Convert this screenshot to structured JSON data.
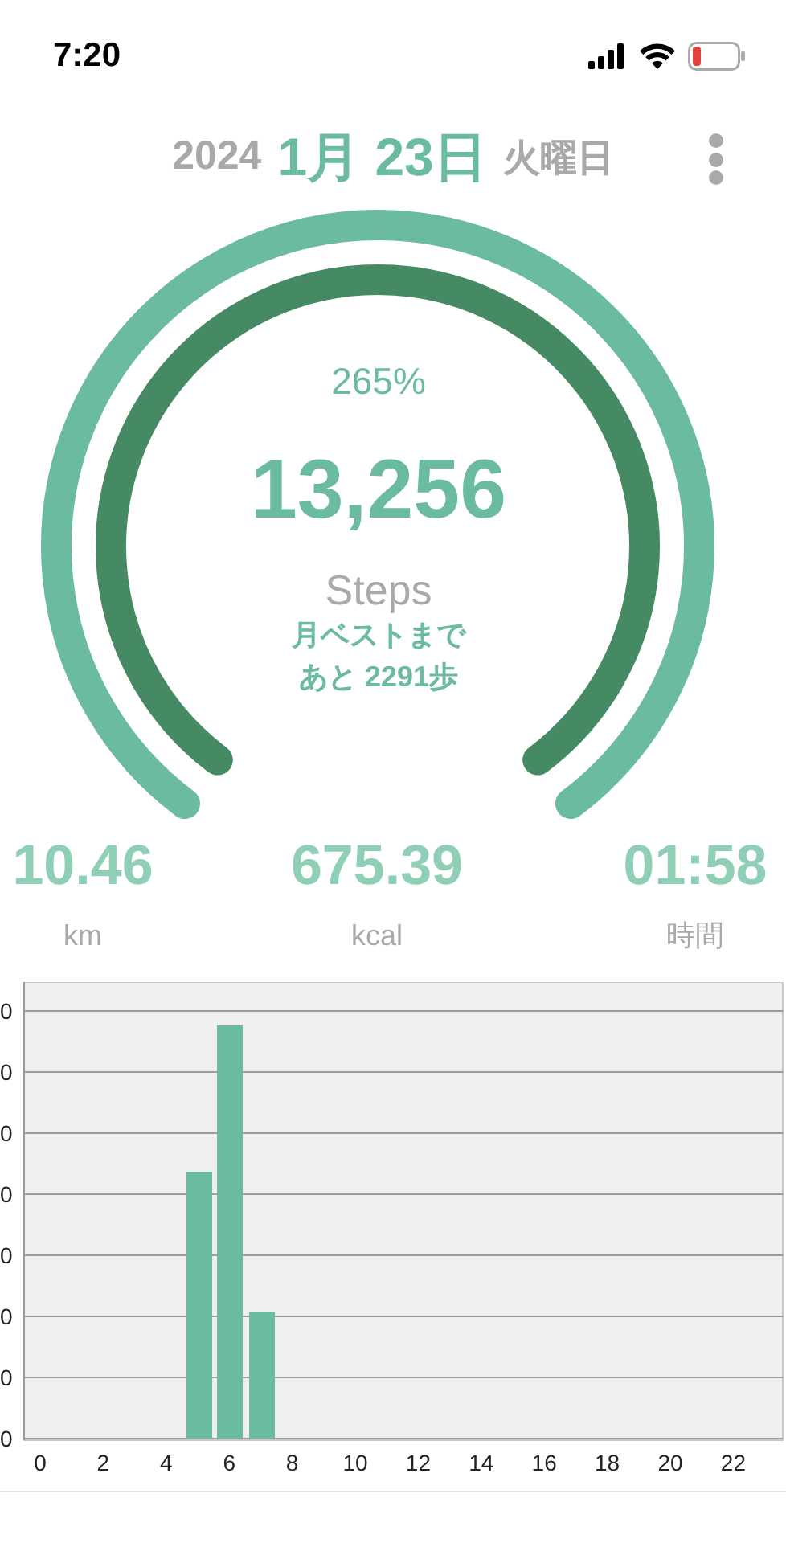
{
  "status_bar": {
    "time": "7:20"
  },
  "header": {
    "year": "2024",
    "date": "1月 23日",
    "weekday": "火曜日"
  },
  "progress": {
    "percent": "265%",
    "steps": "13,256",
    "unit": "Steps",
    "note_lines": [
      "月ベストまで",
      "あと 2291歩"
    ]
  },
  "stats": [
    {
      "value": "10.46",
      "label": "km"
    },
    {
      "value": "675.39",
      "label": "kcal"
    },
    {
      "value": "01:58",
      "label": "時間"
    }
  ],
  "hourly_chart": {
    "y_tick_labels": [
      "0",
      "0",
      "0",
      "0",
      "0",
      "0",
      "0",
      "0"
    ],
    "x_tick_labels": [
      "0",
      "2",
      "4",
      "6",
      "8",
      "10",
      "12",
      "14",
      "16",
      "18",
      "20",
      "22"
    ]
  }
}
